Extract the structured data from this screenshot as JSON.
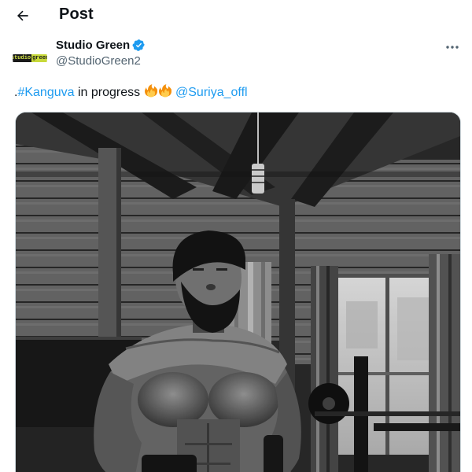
{
  "header": {
    "title": "Post",
    "back_icon": "arrow-left-icon"
  },
  "author": {
    "display_name": "Studio Green",
    "handle": "@StudioGreen2",
    "verified": true,
    "avatar_logo": {
      "part1": "studio",
      "part2": "green"
    }
  },
  "tweet": {
    "prefix": ".",
    "hashtag": "#Kanguva",
    "text_middle": " in progress ",
    "mention": "@Suriya_offl",
    "emojis": [
      "fire-emoji",
      "fire-emoji"
    ]
  },
  "media": {
    "kind": "photo",
    "style": "black-and-white"
  },
  "colors": {
    "link": "#1d9bf0",
    "verified": "#1d9bf0",
    "text": "#0f1419",
    "secondary": "#536471"
  }
}
